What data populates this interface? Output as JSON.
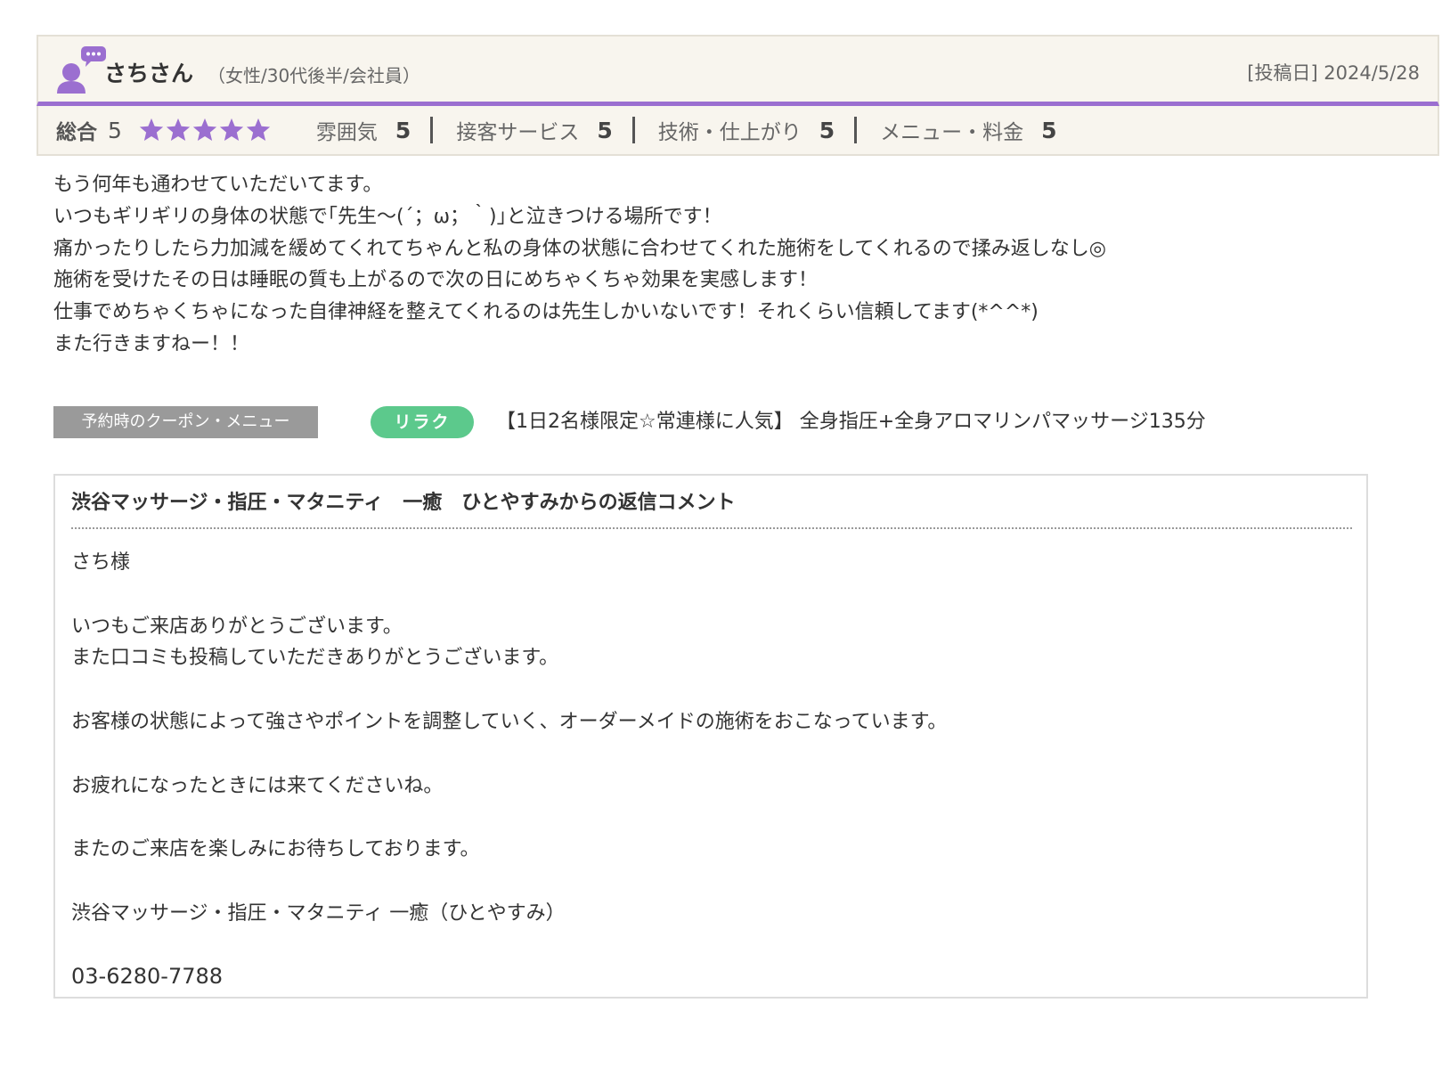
{
  "review": {
    "reviewer_name": "さちさん",
    "reviewer_attrs": "（女性/30代後半/会社員）",
    "post_date": "[投稿日] 2024/5/28",
    "overall_label": "総合",
    "overall_score": "5",
    "stars": 5,
    "star_color": "#9b6fd0",
    "accent_color": "#9b6fd0",
    "sub_ratings": [
      {
        "label": "雰囲気",
        "score": "5"
      },
      {
        "label": "接客サービス",
        "score": "5"
      },
      {
        "label": "技術・仕上がり",
        "score": "5"
      },
      {
        "label": "メニュー・料金",
        "score": "5"
      }
    ],
    "body_lines": [
      "もう何年も通わせていただいてます。",
      "いつもギリギリの身体の状態で｢先生〜(´；ω；｀)｣と泣きつける場所です！",
      "痛かったりしたら力加減を緩めてくれてちゃんと私の身体の状態に合わせてくれた施術をしてくれるので揉み返しなし◎",
      "施術を受けたその日は睡眠の質も上がるので次の日にめちゃくちゃ効果を実感します！",
      "仕事でめちゃくちゃになった自律神経を整えてくれるのは先生しかいないです！それくらい信頼してます(*^^*)",
      "また行きますねー！！"
    ]
  },
  "coupon": {
    "label": "予約時のクーポン・メニュー",
    "badge": "リラク",
    "badge_color": "#5cc98c",
    "name": "【1日2名様限定☆常連様に人気】 全身指圧+全身アロマリンパマッサージ135分"
  },
  "reply": {
    "title": "渋谷マッサージ・指圧・マタニティ　一癒　ひとやすみからの返信コメント",
    "lines": [
      "さち様",
      "",
      "いつもご来店ありがとうございます。",
      "また口コミも投稿していただきありがとうございます。",
      "",
      "お客様の状態によって強さやポイントを調整していく、オーダーメイドの施術をおこなっています。",
      "",
      "お疲れになったときには来てくださいね。",
      "",
      "またのご来店を楽しみにお待ちしております。",
      "",
      "渋谷マッサージ・指圧・マタニティ 一癒（ひとやすみ）",
      "",
      "03-6280-7788"
    ]
  }
}
